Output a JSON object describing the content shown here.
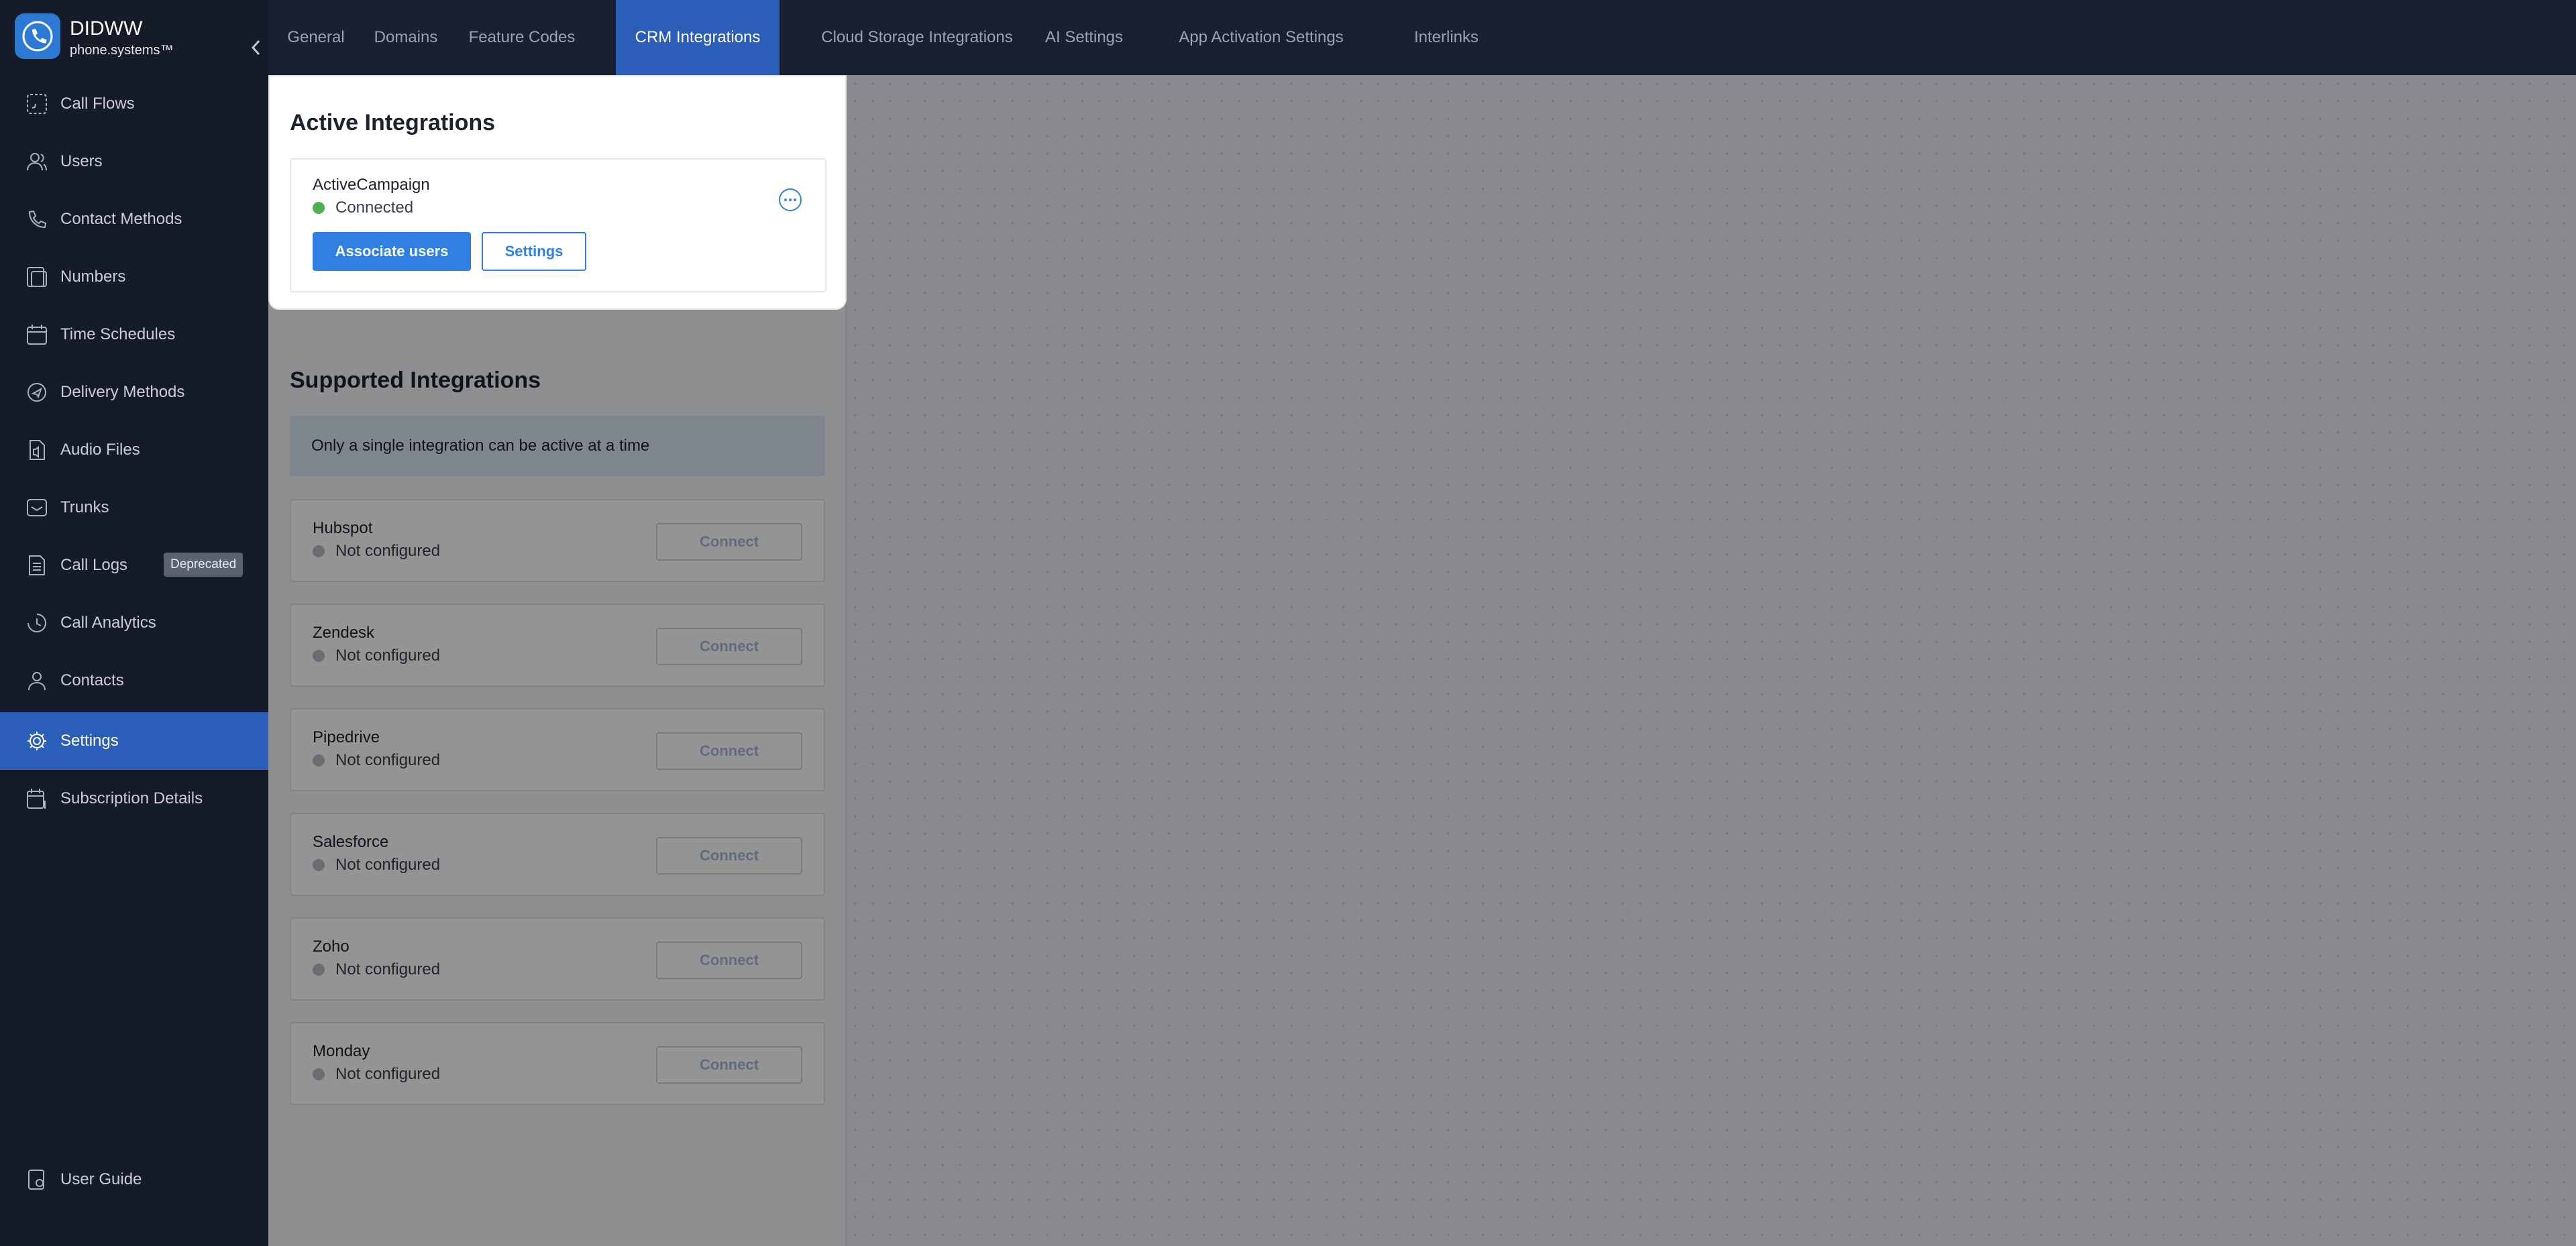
{
  "brand": {
    "name": "DIDWW",
    "subtitle": "phone.systems™"
  },
  "sidebar": {
    "items": [
      {
        "label": "Call Flows",
        "icon": "call-flows-icon"
      },
      {
        "label": "Users",
        "icon": "users-icon"
      },
      {
        "label": "Contact Methods",
        "icon": "contact-methods-icon"
      },
      {
        "label": "Numbers",
        "icon": "numbers-icon"
      },
      {
        "label": "Time Schedules",
        "icon": "calendar-icon"
      },
      {
        "label": "Delivery Methods",
        "icon": "delivery-icon"
      },
      {
        "label": "Audio Files",
        "icon": "audio-file-icon"
      },
      {
        "label": "Trunks",
        "icon": "trunk-icon"
      },
      {
        "label": "Call Logs",
        "icon": "call-logs-icon",
        "badge": "Deprecated"
      },
      {
        "label": "Call Analytics",
        "icon": "analytics-icon"
      },
      {
        "label": "Contacts",
        "icon": "contacts-icon"
      },
      {
        "label": "Settings",
        "icon": "gear-icon",
        "active": true
      },
      {
        "label": "Subscription Details",
        "icon": "subscription-icon"
      }
    ],
    "footer": {
      "label": "User Guide",
      "icon": "user-guide-icon"
    }
  },
  "tabs": [
    {
      "label": "General"
    },
    {
      "label": "Domains"
    },
    {
      "label": "Feature Codes"
    },
    {
      "label": "CRM Integrations",
      "active": true
    },
    {
      "label": "Cloud Storage Integrations"
    },
    {
      "label": "AI Settings"
    },
    {
      "label": "App Activation Settings"
    },
    {
      "label": "Interlinks"
    }
  ],
  "active_integrations": {
    "title": "Active Integrations",
    "item": {
      "name": "ActiveCampaign",
      "status": "Connected",
      "associate_label": "Associate users",
      "settings_label": "Settings"
    }
  },
  "supported_integrations": {
    "title": "Supported Integrations",
    "note": "Only a single integration can be active at a time",
    "connect_label": "Connect",
    "items": [
      {
        "name": "Hubspot",
        "status": "Not configured"
      },
      {
        "name": "Zendesk",
        "status": "Not configured"
      },
      {
        "name": "Pipedrive",
        "status": "Not configured"
      },
      {
        "name": "Salesforce",
        "status": "Not configured"
      },
      {
        "name": "Zoho",
        "status": "Not configured"
      },
      {
        "name": "Monday",
        "status": "Not configured"
      }
    ]
  },
  "colors": {
    "accent": "#2f80e0",
    "active_nav": "#2b5eb8",
    "connected": "#4caf50",
    "not_configured": "#b8bcc4"
  }
}
